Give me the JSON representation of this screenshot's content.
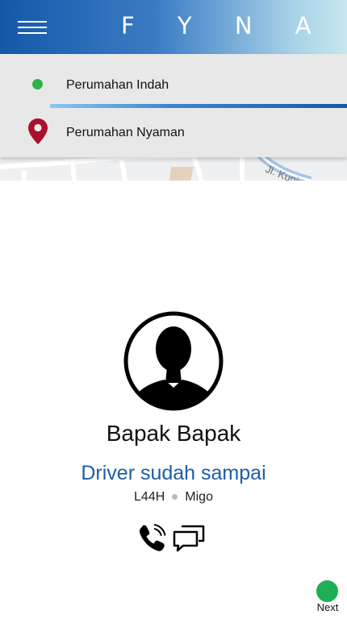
{
  "header": {
    "logo": "F Y N A",
    "gradient": [
      "#1558a8",
      "#c7e7ef"
    ]
  },
  "route": {
    "origin": "Perumahan Indah",
    "destination": "Perumahan Nyaman",
    "origin_color": "#2cb34a",
    "destination_color": "#a8102c"
  },
  "map": {
    "street_label": "Jl. Kunin"
  },
  "driver": {
    "name": "Bapak Bapak",
    "status": "Driver sudah sampai",
    "plate": "L44H",
    "vehicle": "Migo",
    "status_color": "#1d5ea8"
  },
  "actions": {
    "call_icon": "phone-icon",
    "chat_icon": "chat-icon",
    "next_label": "Next",
    "next_color": "#1fae55"
  }
}
